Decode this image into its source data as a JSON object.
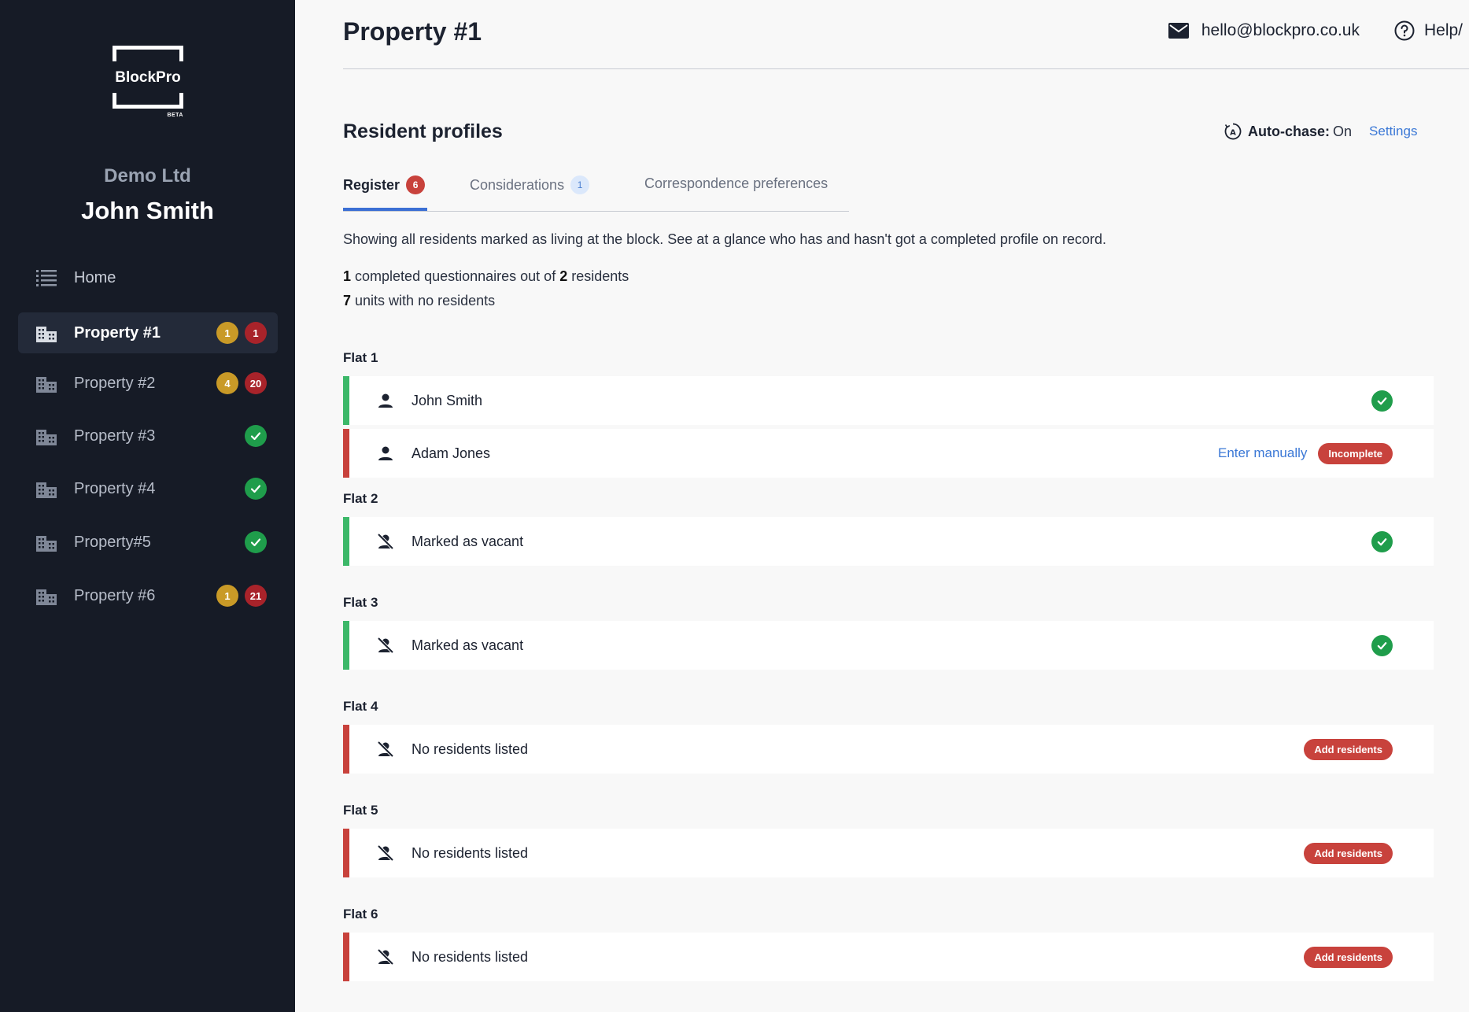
{
  "sidebar": {
    "logo_text": "BlockPro",
    "logo_badge": "BETA",
    "company": "Demo Ltd",
    "user": "John Smith",
    "home_label": "Home",
    "properties": [
      {
        "label": "Property #1",
        "yellow": "1",
        "red": "1",
        "active": true
      },
      {
        "label": "Property #2",
        "yellow": "4",
        "red": "20"
      },
      {
        "label": "Property #3",
        "done": true
      },
      {
        "label": "Property #4",
        "done": true
      },
      {
        "label": "Property#5",
        "done": true
      },
      {
        "label": "Property #6",
        "yellow": "1",
        "red": "21"
      }
    ]
  },
  "header": {
    "title": "Property #1",
    "email": "hello@blockpro.co.uk",
    "help": "Help/"
  },
  "section": {
    "title": "Resident profiles",
    "autochase_label": "Auto-chase:",
    "autochase_value": "On",
    "settings_link": "Settings",
    "tabs": [
      {
        "label": "Register",
        "count": "6"
      },
      {
        "label": "Considerations",
        "count": "1"
      },
      {
        "label": "Correspondence preferences"
      }
    ],
    "description": "Showing all residents marked as living at the block. See at a glance who has and hasn't got a completed profile on record.",
    "stat_completed_count": "1",
    "stat_completed_mid": "completed questionnaires out of",
    "stat_residents_count": "2",
    "stat_residents_label": "residents",
    "stat_units_count": "7",
    "stat_units_label": "units with no residents"
  },
  "flats": [
    {
      "label": "Flat 1",
      "rows": [
        {
          "text": "John Smith",
          "icon": "person-icon",
          "status": "complete"
        },
        {
          "text": "Adam Jones",
          "icon": "person-icon",
          "status": "incomplete",
          "link": "Enter manually",
          "badge": "Incomplete"
        }
      ]
    },
    {
      "label": "Flat 2",
      "rows": [
        {
          "text": "Marked as vacant",
          "icon": "no-person-icon",
          "status": "complete"
        }
      ]
    },
    {
      "label": "Flat 3",
      "rows": [
        {
          "text": "Marked as vacant",
          "icon": "no-person-icon",
          "status": "complete"
        }
      ]
    },
    {
      "label": "Flat 4",
      "rows": [
        {
          "text": "No residents listed",
          "icon": "no-person-icon",
          "status": "empty",
          "badge": "Add residents"
        }
      ]
    },
    {
      "label": "Flat 5",
      "rows": [
        {
          "text": "No residents listed",
          "icon": "no-person-icon",
          "status": "empty",
          "badge": "Add residents"
        }
      ]
    },
    {
      "label": "Flat 6",
      "rows": [
        {
          "text": "No residents listed",
          "icon": "no-person-icon",
          "status": "empty",
          "badge": "Add residents"
        }
      ]
    }
  ],
  "colors": {
    "sidebar_bg": "#161b26",
    "accent_blue": "#3b6fd4",
    "success_green": "#1f9d4b",
    "danger_red": "#c8423c",
    "warning_yellow": "#c99a27"
  }
}
